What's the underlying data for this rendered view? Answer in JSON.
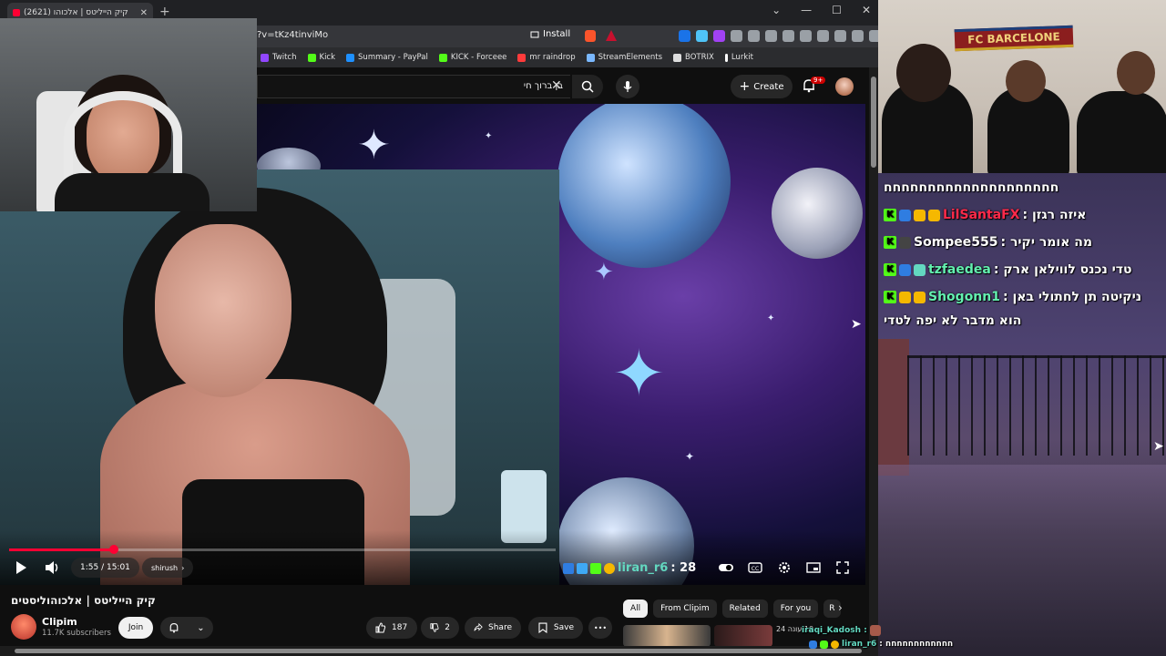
{
  "browser": {
    "tab_title": "קיק הייליטס | אלכוהו (2621)",
    "tab_close": "✕",
    "new_tab": "+",
    "window_controls": [
      "⌄",
      "—",
      "☐",
      "✕"
    ],
    "url": "?v=tKz4tinviMo",
    "install_label": "Install",
    "bookmarks": [
      {
        "label": "Twitch",
        "color": "#9146ff"
      },
      {
        "label": "Kick",
        "color": "#53fc18"
      },
      {
        "label": "Summary - PayPal",
        "color": "#1e90ff"
      },
      {
        "label": "KICK - Forceee",
        "color": "#53fc18"
      },
      {
        "label": "mr raindrop",
        "color": "#ff3b3b"
      },
      {
        "label": "StreamElements",
        "color": "#7ab8ff"
      },
      {
        "label": "BOTRIX",
        "color": "#dddddd"
      },
      {
        "label": "Lurkit",
        "color": "#ffffff"
      }
    ]
  },
  "youtube": {
    "search_value": "בן ברוך חי",
    "search_clear": "✕",
    "create_label": "Create",
    "notif_badge": "9+",
    "video": {
      "time": "1:55 / 15:01",
      "chapter": "shirush",
      "progress_fraction": 0.192,
      "overlay_user": "liran_r6",
      "overlay_text": ": 28"
    },
    "title": "קיק הייליטס | אלכוהוליסטים",
    "channel": "Clipim",
    "subscribers": "11.7K subscribers",
    "join_label": "Join",
    "likes": "187",
    "dislikes": "2",
    "share_label": "Share",
    "save_label": "Save",
    "more_label": "•••",
    "chips": [
      "All",
      "From Clipim",
      "Related",
      "For you",
      "R"
    ],
    "related_text": "10 ‏עונה‏ 24"
  },
  "room": {
    "banner": "FC BARCELONE"
  },
  "chat": {
    "lines": [
      {
        "user": "",
        "message": "חחחחחחחחחחחחחחחחחחחח",
        "user_color": "#ffffff",
        "badges": []
      },
      {
        "user": "LilSantaFX",
        "message": "איזה רגזן :",
        "user_color": "#ff2a4a",
        "badges": [
          "kick",
          "blue",
          "gold",
          "gold"
        ]
      },
      {
        "user": "Sompee555",
        "message": "מה אומר יקיר :",
        "user_color": "#ffffff",
        "badges": [
          "kick",
          "dark"
        ]
      },
      {
        "user": "tzfaedea",
        "message": "טדי נכנס לווילאן ארק :",
        "user_color": "#63f0b0",
        "badges": [
          "kick",
          "blue",
          "teal"
        ]
      },
      {
        "user": "Shogonn1",
        "message": "ניקיטה תן לחתולי באן :",
        "user_color": "#63f0b0",
        "badges": [
          "kick",
          "gold",
          "gold"
        ]
      },
      {
        "user": "",
        "message": "הוא מדבר לא יפה לטדי",
        "user_color": "#ffffff",
        "badges": []
      }
    ],
    "bottom_user": "liran_r6",
    "bottom_msg": ": חחחחחחחחחחחח",
    "bottom_user2": "iraqi_Kadosh :"
  }
}
